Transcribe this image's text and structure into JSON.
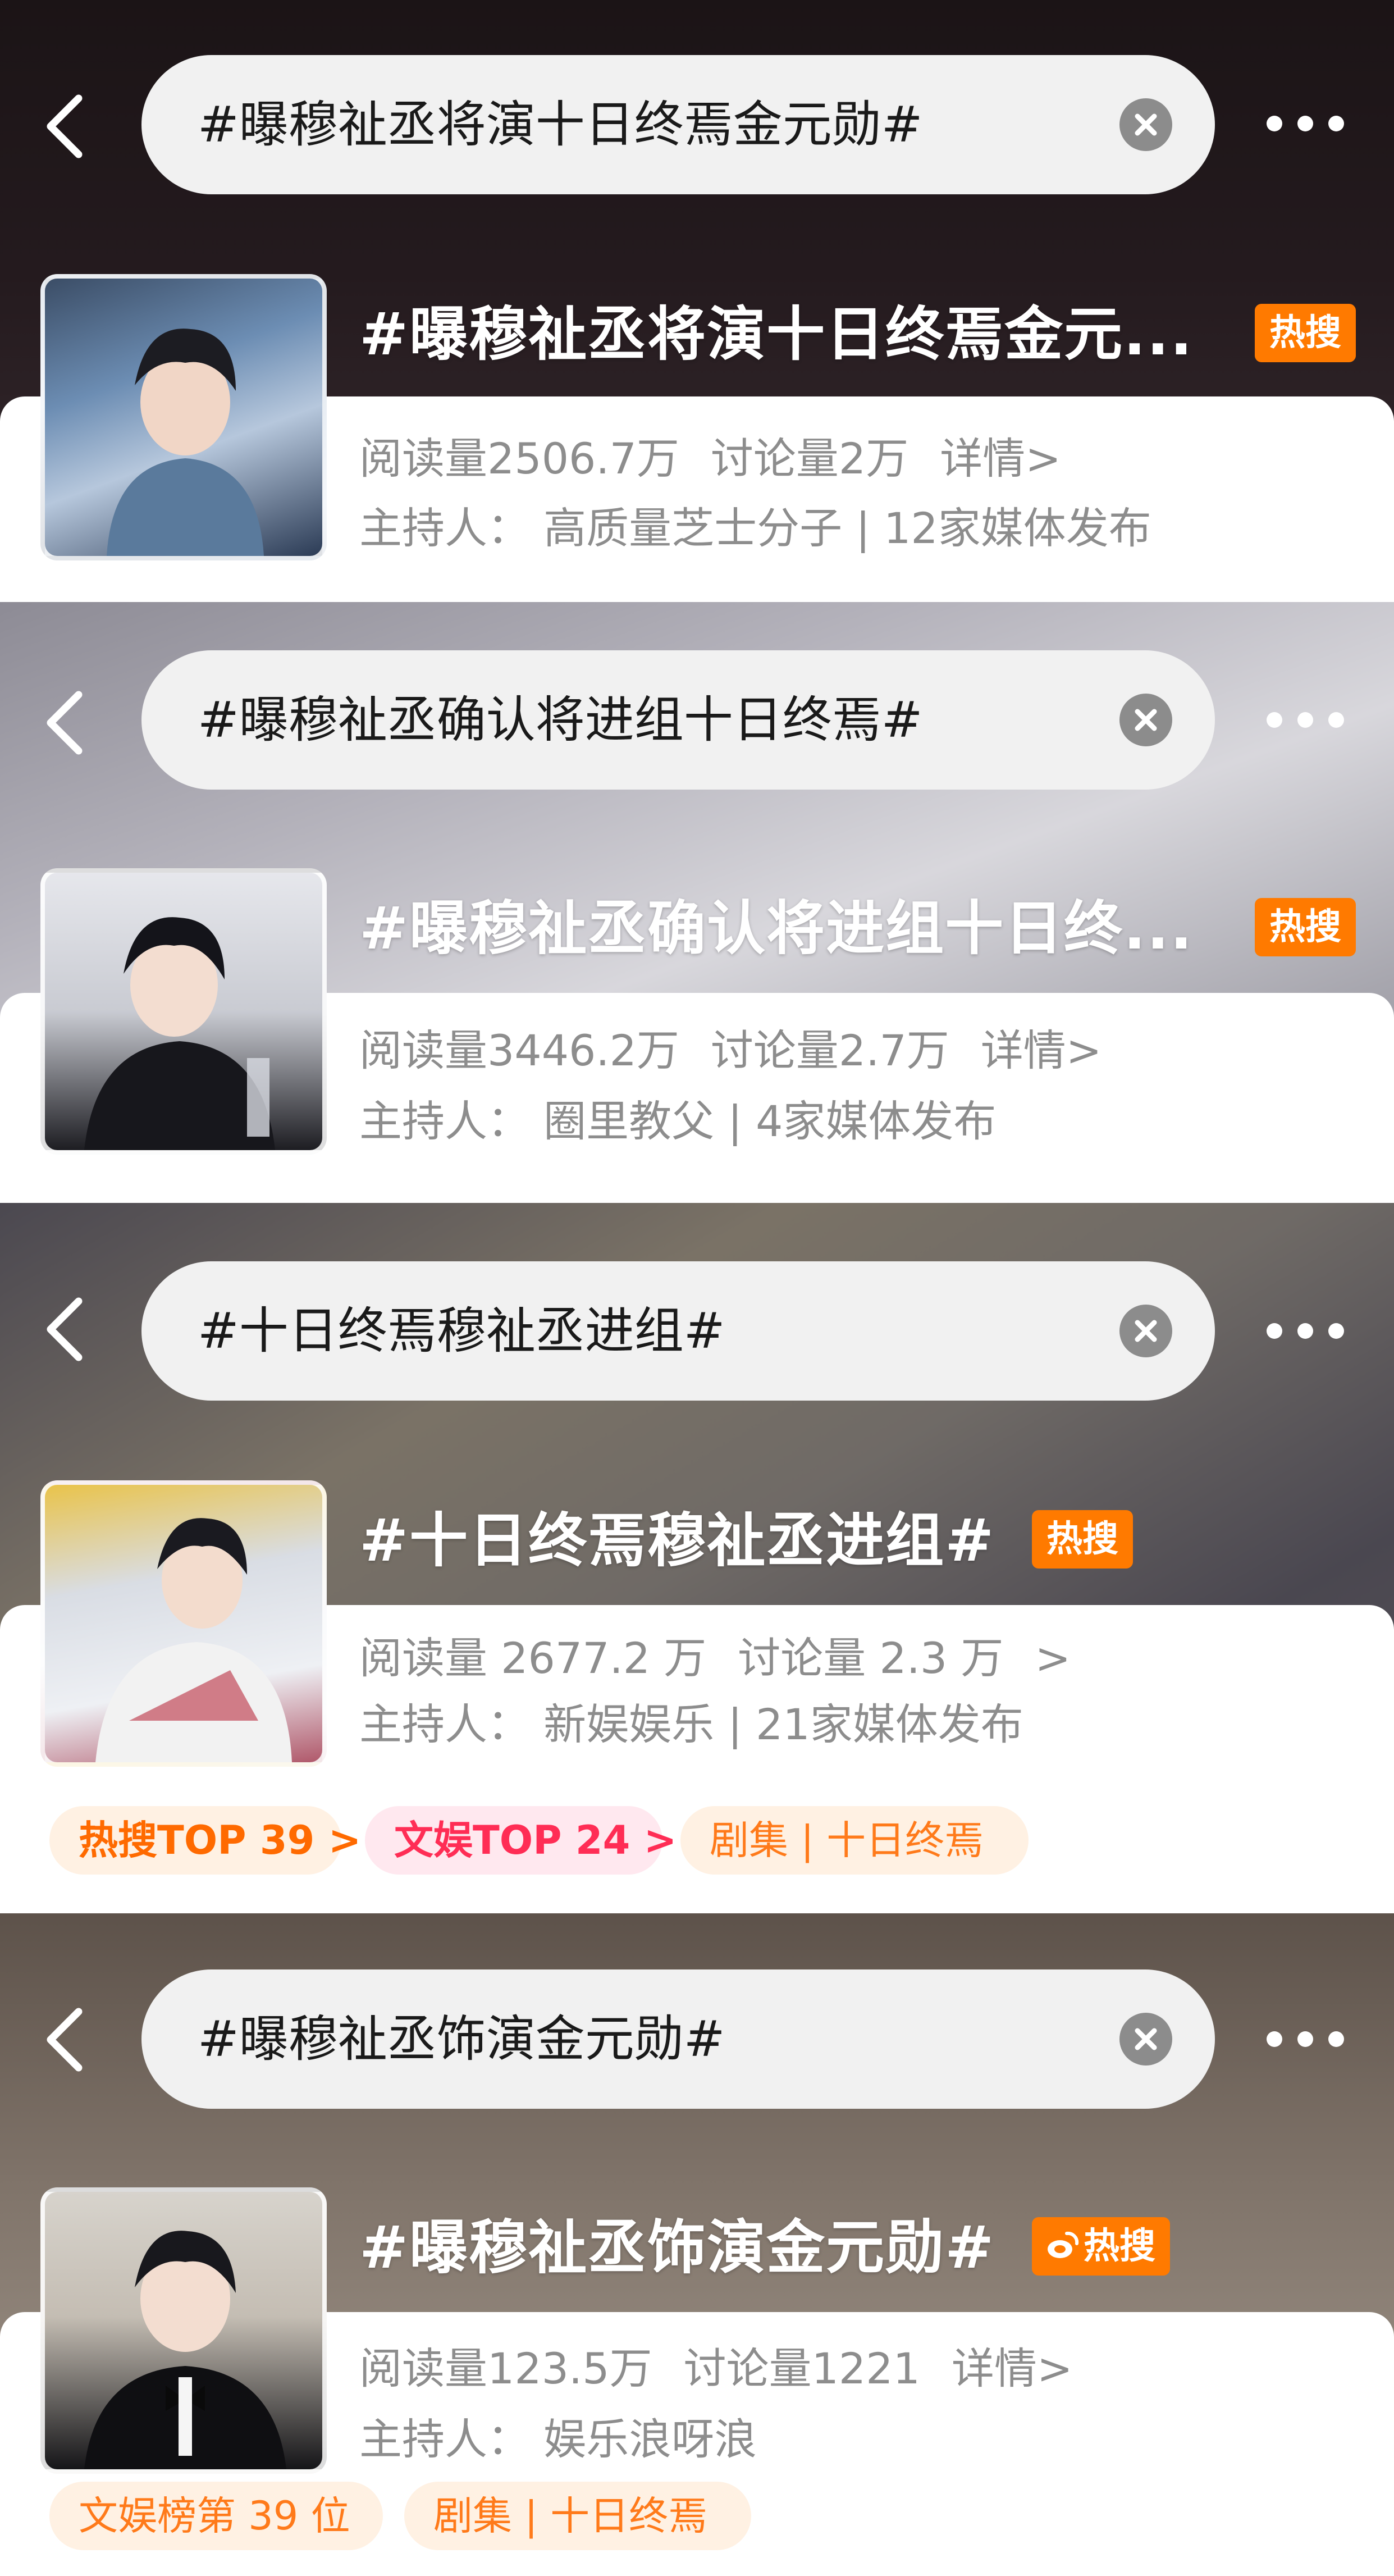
{
  "sections": [
    {
      "query": "#曝穆祉丞将演十日终焉金元勋#",
      "title": "#曝穆祉丞将演十日终焉金元...",
      "hot": "热搜",
      "reads": "阅读量2506.7万",
      "discussions": "讨论量2万",
      "details": "详情>",
      "host": "主持人：  高质量芝士分子 | 12家媒体发布"
    },
    {
      "query": "#曝穆祉丞确认将进组十日终焉#",
      "title": "#曝穆祉丞确认将进组十日终...",
      "hot": "热搜",
      "reads": "阅读量3446.2万",
      "discussions": "讨论量2.7万",
      "details": "详情>",
      "host": "主持人：  圈里教父 | 4家媒体发布"
    },
    {
      "query": "#十日终焉穆祉丞进组#",
      "title": "#十日终焉穆祉丞进组#",
      "hot": "热搜",
      "reads": "阅读量 2677.2 万",
      "discussions": "讨论量 2.3 万",
      "details": ">",
      "host": "主持人：  新娱娱乐 | 21家媒体发布",
      "tags": [
        "热搜TOP 39 >",
        "文娱TOP 24 >",
        "剧集 | 十日终焉"
      ]
    },
    {
      "query": "#曝穆祉丞饰演金元勋#",
      "title": "#曝穆祉丞饰演金元勋#",
      "hot": "热搜",
      "reads": "阅读量123.5万",
      "discussions": "讨论量1221",
      "details": "详情>",
      "host": "主持人：  娱乐浪呀浪",
      "tags": [
        "文娱榜第 39 位",
        "剧集 | 十日终焉"
      ]
    }
  ],
  "colors": {
    "hot_badge": "#ff7a00",
    "stat_text": "#8d8d8d",
    "tag_orange": "#ff6a00",
    "tag_pink": "#ff2d55"
  }
}
